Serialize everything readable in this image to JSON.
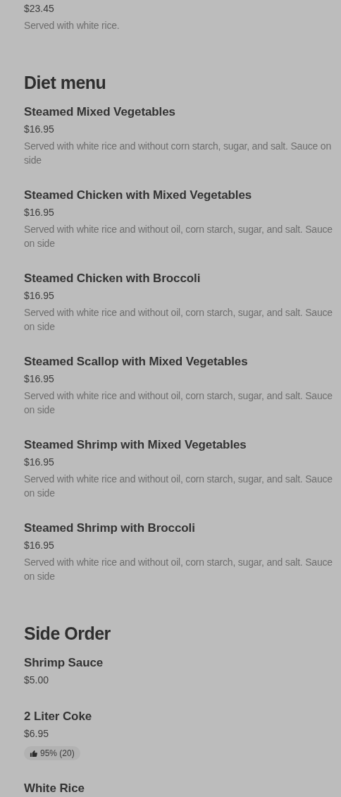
{
  "sections": [
    {
      "items": [
        {
          "price": "$23.45",
          "description": "Served with white rice."
        }
      ]
    },
    {
      "heading": "Diet menu",
      "items": [
        {
          "title": "Steamed Mixed Vegetables",
          "price": "$16.95",
          "description": "Served with white rice and without corn starch, sugar, and salt. Sauce on side"
        },
        {
          "title": "Steamed Chicken with Mixed Vegetables",
          "price": "$16.95",
          "description": "Served with white rice and without oil, corn starch, sugar, and salt. Sauce on side"
        },
        {
          "title": "Steamed Chicken with Broccoli",
          "price": "$16.95",
          "description": "Served with white rice and without oil, corn starch, sugar, and salt. Sauce on side"
        },
        {
          "title": "Steamed Scallop with Mixed Vegetables",
          "price": "$16.95",
          "description": "Served with white rice and without oil, corn starch, sugar, and salt. Sauce on side"
        },
        {
          "title": "Steamed Shrimp with Mixed Vegetables",
          "price": "$16.95",
          "description": "Served with white rice and without oil, corn starch, sugar, and salt. Sauce on side"
        },
        {
          "title": "Steamed Shrimp with Broccoli",
          "price": "$16.95",
          "description": "Served with white rice and without oil, corn starch, sugar, and salt. Sauce on side"
        }
      ]
    },
    {
      "heading": "Side Order",
      "items": [
        {
          "title": "Shrimp Sauce",
          "price": "$5.00"
        },
        {
          "title": "2 Liter Coke",
          "price": "$6.95",
          "rating": "95% (20)"
        },
        {
          "title": "White Rice"
        }
      ]
    }
  ]
}
